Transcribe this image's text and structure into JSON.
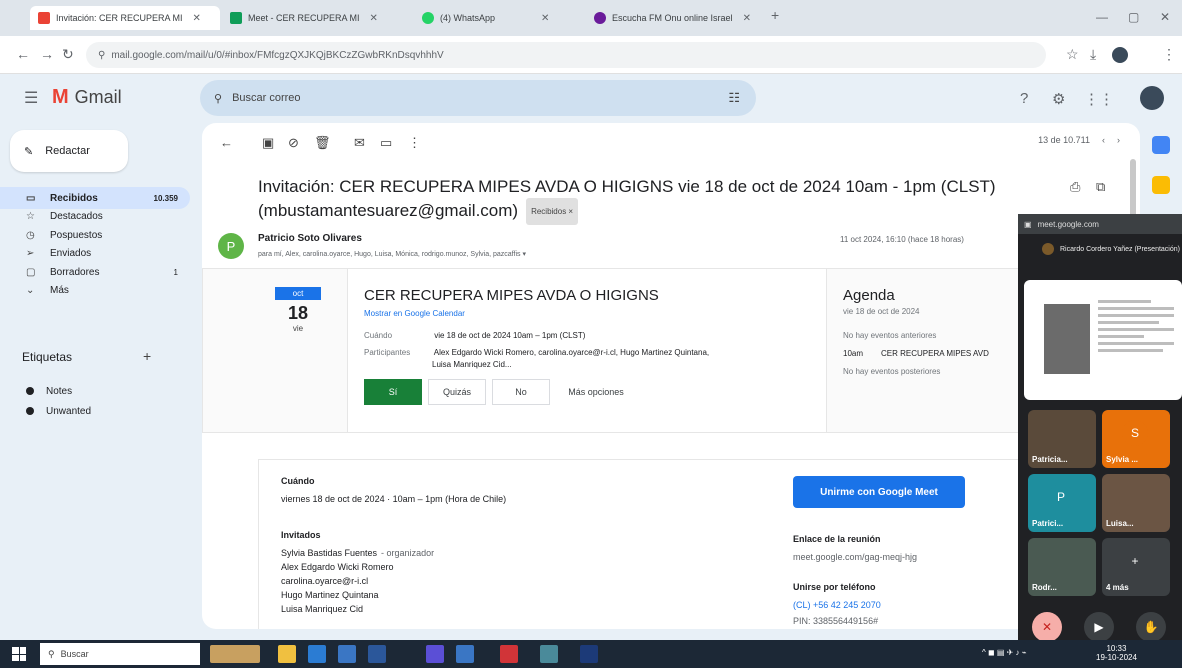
{
  "browser": {
    "tabs": [
      {
        "label": "Invitación: CER RECUPERA MI",
        "fav_color": "#ea4335",
        "active": true
      },
      {
        "label": "Meet - CER RECUPERA MI",
        "fav_color": "#0f9d58",
        "active": false
      },
      {
        "label": "(4) WhatsApp",
        "fav_color": "#25d366",
        "active": false
      },
      {
        "label": "Escucha FM Onu online Israel",
        "fav_color": "#6a1b9a",
        "active": false
      }
    ],
    "url": "mail.google.com/mail/u/0/#inbox/FMfcgzQXJKQjBKCzZGwbRKnDsqvhhhV"
  },
  "gmail": {
    "brand": "Gmail",
    "search_placeholder": "Buscar correo",
    "compose_label": "Redactar",
    "nav": [
      {
        "label": "Recibidos",
        "count": "10.359",
        "active": true,
        "icon": "inbox-icon",
        "glyph": "▭"
      },
      {
        "label": "Destacados",
        "count": "",
        "active": false,
        "icon": "star-icon",
        "glyph": "☆"
      },
      {
        "label": "Pospuestos",
        "count": "",
        "active": false,
        "icon": "clock-icon",
        "glyph": "◷"
      },
      {
        "label": "Enviados",
        "count": "",
        "active": false,
        "icon": "send-icon",
        "glyph": "➢"
      },
      {
        "label": "Borradores",
        "count": "1",
        "active": false,
        "icon": "draft-icon",
        "glyph": "▢"
      },
      {
        "label": "Más",
        "count": "",
        "active": false,
        "icon": "chevron-down-icon",
        "glyph": "⌄"
      }
    ],
    "labels_heading": "Etiquetas",
    "labels": [
      {
        "label": "Notes"
      },
      {
        "label": "Unwanted"
      }
    ]
  },
  "mail": {
    "pager": "13 de 10.711",
    "subject": "Invitación: CER RECUPERA MIPES AVDA O HIGIGNS vie 18 de oct de 2024 10am - 1pm (CLST) (mbustamantesuarez@gmail.com)",
    "badge": "Recibidos ×",
    "sender_initial": "P",
    "sender": "Patricio Soto Olivares",
    "recipients": "para mí, Alex, carolina.oyarce, Hugo, Luisa, Mónica, rodrigo.munoz, Sylvia, pazcaffis ▾",
    "date": "11 oct 2024, 16:10 (hace 18 horas)",
    "invite": {
      "month": "oct",
      "day": "18",
      "dow": "vie",
      "title": "CER RECUPERA MIPES AVDA O HIGIGNS",
      "calendar_link": "Mostrar en Google Calendar",
      "when_key": "Cuándo",
      "when_val": "vie 18 de oct de 2024 10am – 1pm (CLST)",
      "who_key": "Participantes",
      "who_val": "Alex Edgardo Wicki Romero, carolina.oyarce@r-i.cl, Hugo Martinez Quintana,",
      "who_val2": "Luisa Manriquez Cid...",
      "rsvp_yes": "Sí",
      "rsvp_maybe": "Quizás",
      "rsvp_no": "No",
      "more_options": "Más opciones",
      "agenda_title": "Agenda",
      "agenda_date": "vie 18 de oct de 2024",
      "agenda_before": "No hay eventos anteriores",
      "agenda_time": "10am",
      "agenda_event": "CER RECUPERA MIPES AVD",
      "agenda_after": "No hay eventos posteriores"
    },
    "details": {
      "when_h": "Cuándo",
      "when": "viernes 18 de oct de 2024 · 10am – 1pm (Hora de Chile)",
      "guests_h": "Invitados",
      "guests": [
        {
          "name": "Sylvia Bastidas Fuentes",
          "role": "- organizador"
        },
        {
          "name": "Alex Edgardo Wicki Romero",
          "role": ""
        },
        {
          "name": "carolina.oyarce@r-i.cl",
          "role": ""
        },
        {
          "name": "Hugo Martinez Quintana",
          "role": ""
        },
        {
          "name": "Luisa Manriquez Cid",
          "role": ""
        }
      ],
      "meet_button": "Unirme con Google Meet",
      "link_h": "Enlace de la reunión",
      "link": "meet.google.com/gag-meqj-hjg",
      "phone_h": "Unirse por teléfono",
      "phone": "(CL) +56 42 245 2070",
      "pin": "PIN: 338556449156#"
    }
  },
  "pip": {
    "host": "meet.google.com",
    "presenter": "Ricardo Cordero Yañez (Presentación)",
    "tiles": [
      {
        "label": "Patricia...",
        "initial": "",
        "color": "#5a4a3a"
      },
      {
        "label": "Sylvia ...",
        "initial": "S",
        "color": "#e8710a"
      },
      {
        "label": "Patrici...",
        "initial": "P",
        "color": "#1e8e9e"
      },
      {
        "label": "Luisa...",
        "initial": "",
        "color": "#6b5544"
      },
      {
        "label": "Rodr...",
        "initial": "",
        "color": "#4a5a52"
      },
      {
        "label": "4 más",
        "initial": "+",
        "color": "#3c4043"
      }
    ]
  },
  "taskbar": {
    "search": "Buscar",
    "time": "10:33",
    "date": "19-10-2024"
  }
}
